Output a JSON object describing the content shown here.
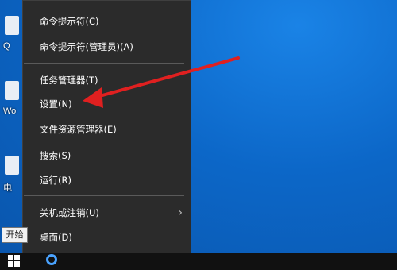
{
  "desktop": {
    "icons": [
      {
        "label": "Q",
        "icon": "qq-icon"
      },
      {
        "label": "Wo",
        "icon": "word-icon"
      },
      {
        "label": "电",
        "icon": "computer-icon"
      }
    ]
  },
  "start_menu": {
    "items": [
      {
        "label": "命令提示符(C)"
      },
      {
        "label": "命令提示符(管理员)(A)"
      },
      {
        "label": "任务管理器(T)"
      },
      {
        "label": "设置(N)"
      },
      {
        "label": "文件资源管理器(E)"
      },
      {
        "label": "搜索(S)"
      },
      {
        "label": "运行(R)"
      },
      {
        "label": "关机或注销(U)"
      },
      {
        "label": "桌面(D)"
      }
    ],
    "submenu_chevron": "›"
  },
  "tooltip": {
    "text": "开始"
  },
  "annotation": {
    "arrow_color": "#e02020"
  },
  "colors": {
    "menu_bg": "#2b2b2b",
    "desktop_blue": "#0c67c8",
    "taskbar": "#111111"
  }
}
